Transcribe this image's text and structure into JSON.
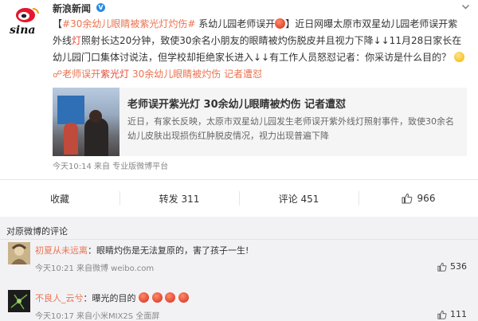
{
  "post": {
    "author": "新浪新闻",
    "verified_badge": "V",
    "hashtag": "#30余幼儿眼睛被紫光灯灼伤#",
    "text_1": " 系幼儿园老师误开",
    "text_2": "】近日网曝太原市双星幼儿园老师误开紫外线",
    "text_3": "灯",
    "text_4": "照射长达20分钟，致使30余名小朋友的眼睛被灼伤脱皮并且视力下降↓↓11月28日家长在幼儿园门口集体讨说法，但学校却拒绝家长进入↓↓有工作人员怒怼记者：你采访是什么目的？",
    "link_1": "老师误开",
    "link_1_red": "紫光灯",
    "link_2": " 30余幼儿眼睛被灼伤 记者遭怼",
    "card": {
      "title": "老师误开紫光灯 30余幼儿眼睛被灼伤 记者遭怼",
      "desc": "近日，有家长反映，太原市双星幼儿园发生老师误开紫外线灯照射事件，致使30余名幼儿皮肤出现损伤红肿脱皮情况，视力出现普遍下降"
    },
    "meta": "今天10:14 来自 专业版微博平台",
    "actions": {
      "favorite": "收藏",
      "repost": "转发 311",
      "comment": "评论 451",
      "like": "966"
    }
  },
  "comments": {
    "title": "对原微博的评论",
    "items": [
      {
        "user": "初夏从未远离",
        "text": "：眼睛灼伤是无法复原的，害了孩子一生!",
        "time": "今天10:21 来自微博 weibo.com",
        "likes": "536"
      },
      {
        "user": "不良人_云兮",
        "text": "：曝光的目的",
        "time": "今天10:17 来自小米MIX2S 全面屏",
        "likes": "111"
      }
    ]
  },
  "colors": {
    "accent": "#eb7350",
    "red": "#e54b3c",
    "text": "#333333",
    "muted": "#888888",
    "background": "#f2f2f5"
  }
}
